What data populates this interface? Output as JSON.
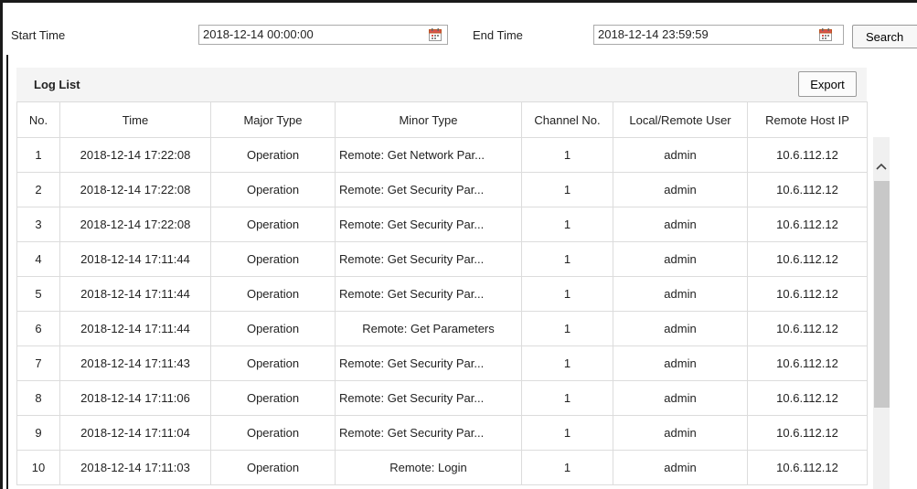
{
  "filter": {
    "start_label": "Start Time",
    "start_value": "2018-12-14 00:00:00",
    "end_label": "End Time",
    "end_value": "2018-12-14 23:59:59",
    "search_label": "Search",
    "calendar_icon": "calendar-icon"
  },
  "loglist": {
    "title": "Log List",
    "export_label": "Export",
    "columns": [
      "No.",
      "Time",
      "Major Type",
      "Minor Type",
      "Channel No.",
      "Local/Remote User",
      "Remote Host IP"
    ],
    "rows": [
      {
        "no": "1",
        "time": "2018-12-14 17:22:08",
        "major": "Operation",
        "minor": "Remote: Get Network Par...",
        "channel": "1",
        "user": "admin",
        "ip": "10.6.112.12"
      },
      {
        "no": "2",
        "time": "2018-12-14 17:22:08",
        "major": "Operation",
        "minor": "Remote: Get Security Par...",
        "channel": "1",
        "user": "admin",
        "ip": "10.6.112.12"
      },
      {
        "no": "3",
        "time": "2018-12-14 17:22:08",
        "major": "Operation",
        "minor": "Remote: Get Security Par...",
        "channel": "1",
        "user": "admin",
        "ip": "10.6.112.12"
      },
      {
        "no": "4",
        "time": "2018-12-14 17:11:44",
        "major": "Operation",
        "minor": "Remote: Get Security Par...",
        "channel": "1",
        "user": "admin",
        "ip": "10.6.112.12"
      },
      {
        "no": "5",
        "time": "2018-12-14 17:11:44",
        "major": "Operation",
        "minor": "Remote: Get Security Par...",
        "channel": "1",
        "user": "admin",
        "ip": "10.6.112.12"
      },
      {
        "no": "6",
        "time": "2018-12-14 17:11:44",
        "major": "Operation",
        "minor": "Remote: Get Parameters",
        "channel": "1",
        "user": "admin",
        "ip": "10.6.112.12"
      },
      {
        "no": "7",
        "time": "2018-12-14 17:11:43",
        "major": "Operation",
        "minor": "Remote: Get Security Par...",
        "channel": "1",
        "user": "admin",
        "ip": "10.6.112.12"
      },
      {
        "no": "8",
        "time": "2018-12-14 17:11:06",
        "major": "Operation",
        "minor": "Remote: Get Security Par...",
        "channel": "1",
        "user": "admin",
        "ip": "10.6.112.12"
      },
      {
        "no": "9",
        "time": "2018-12-14 17:11:04",
        "major": "Operation",
        "minor": "Remote: Get Security Par...",
        "channel": "1",
        "user": "admin",
        "ip": "10.6.112.12"
      },
      {
        "no": "10",
        "time": "2018-12-14 17:11:03",
        "major": "Operation",
        "minor": "Remote: Login",
        "channel": "1",
        "user": "admin",
        "ip": "10.6.112.12"
      }
    ]
  },
  "scrollbar": {
    "up_icon": "chevron-up-icon"
  }
}
